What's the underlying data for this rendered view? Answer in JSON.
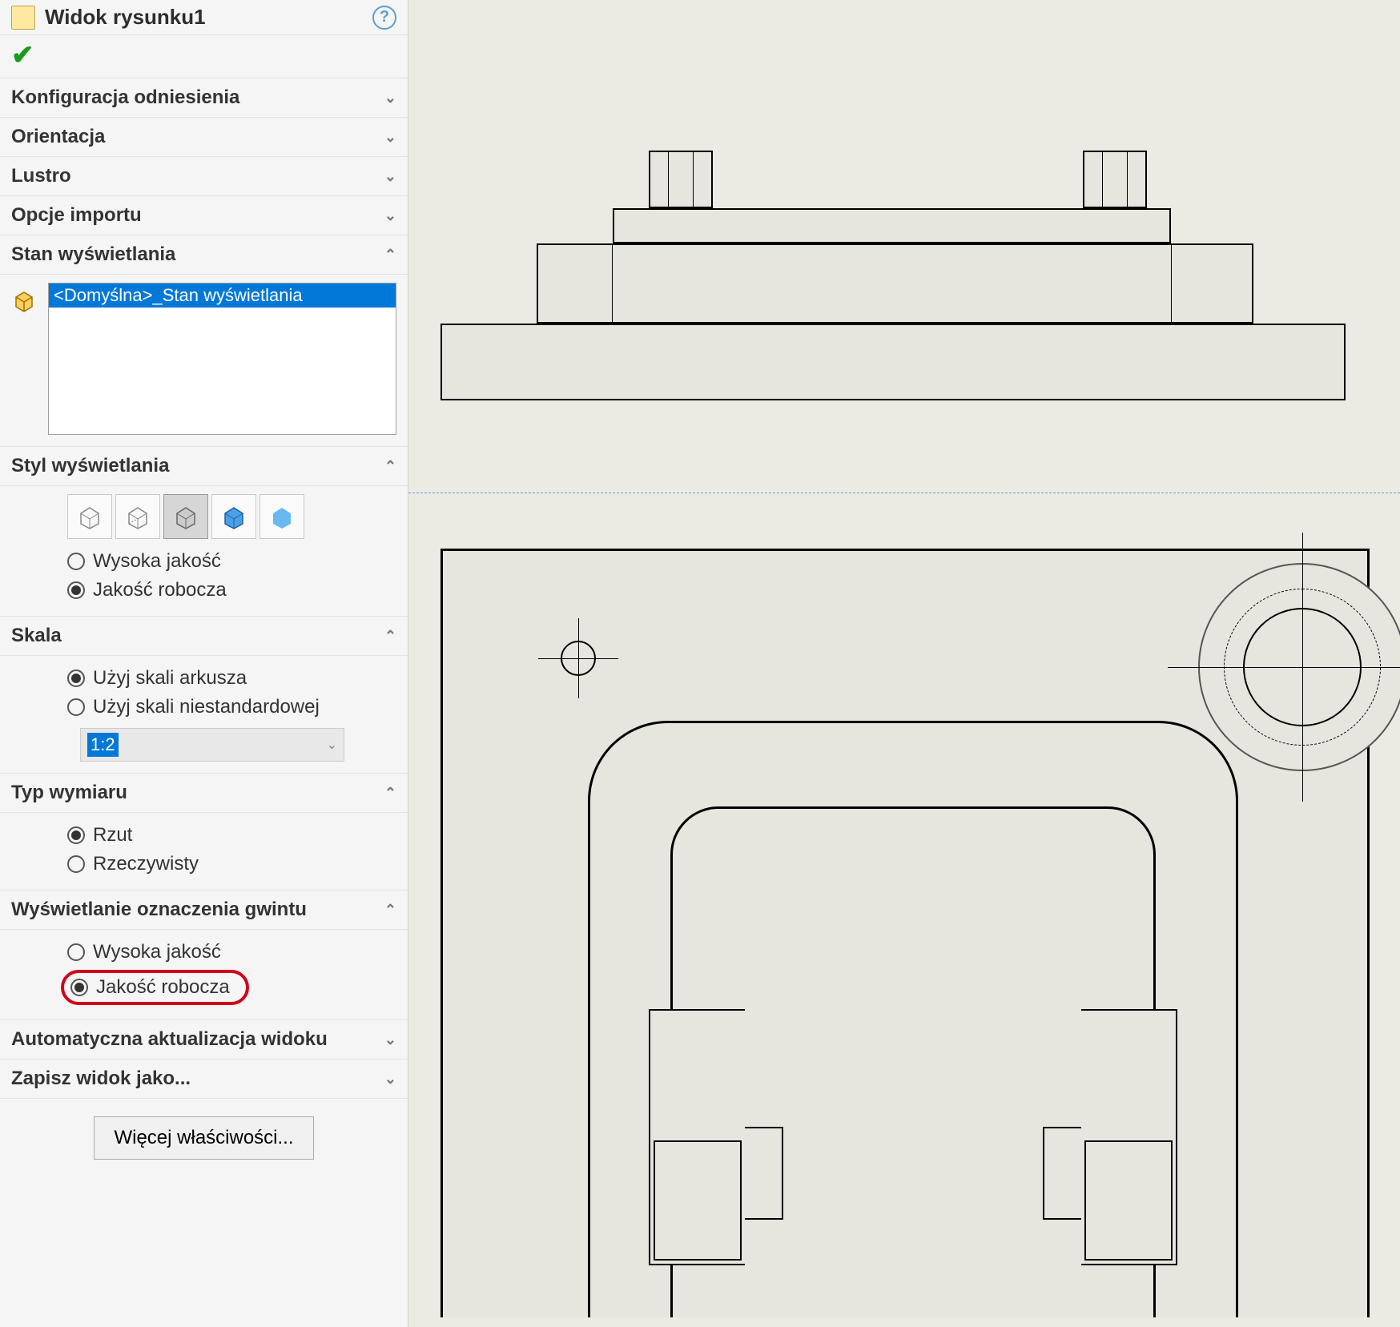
{
  "header": {
    "title": "Widok rysunku1"
  },
  "sections": {
    "reference_config": "Konfiguracja odniesienia",
    "orientation": "Orientacja",
    "mirror": "Lustro",
    "import_options": "Opcje importu",
    "display_state": "Stan wyświetlania",
    "display_style": "Styl wyświetlania",
    "scale": "Skala",
    "dimension_type": "Typ wymiaru",
    "thread_display": "Wyświetlanie oznaczenia gwintu",
    "auto_update": "Automatyczna aktualizacja widoku",
    "save_as": "Zapisz widok jako..."
  },
  "display_state_list": {
    "items": [
      "<Domyślna>_Stan wyświetlania"
    ],
    "selected": 0
  },
  "display_style": {
    "radio_high": "Wysoka jakość",
    "radio_draft": "Jakość robocza",
    "selected": "draft"
  },
  "scale": {
    "radio_sheet": "Użyj skali arkusza",
    "radio_custom": "Użyj skali niestandardowej",
    "selected": "sheet",
    "value": "1:2"
  },
  "dimension_type": {
    "radio_projected": "Rzut",
    "radio_true": "Rzeczywisty",
    "selected": "projected"
  },
  "thread_display": {
    "radio_high": "Wysoka jakość",
    "radio_draft": "Jakość robocza",
    "selected": "draft"
  },
  "more_props_button": "Więcej właściwości..."
}
